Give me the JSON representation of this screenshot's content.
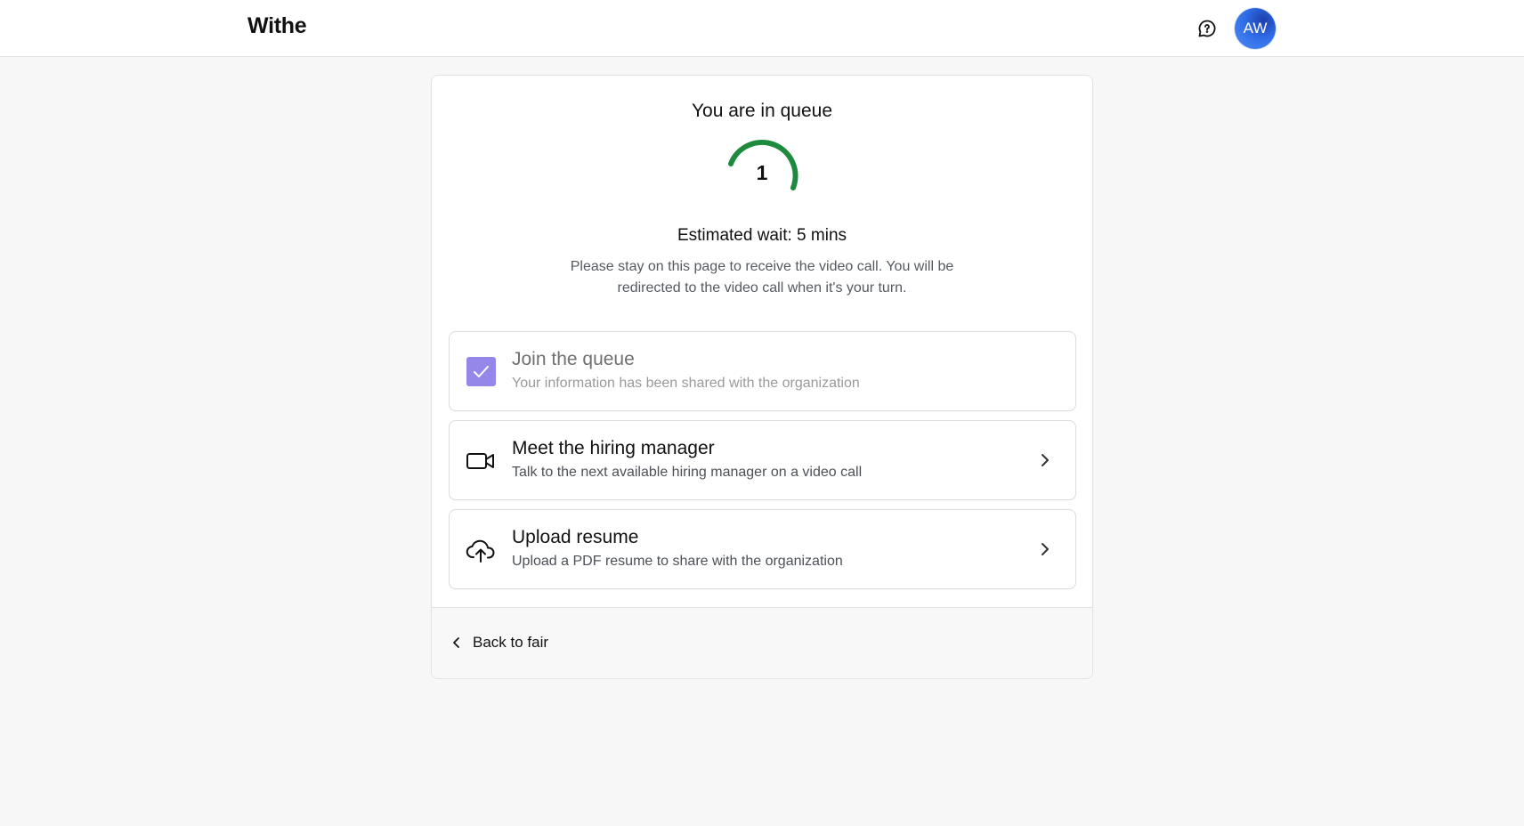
{
  "app": {
    "brand": "Withe",
    "avatar_initials": "AW",
    "icons": {
      "chat": "chat-bubble-question-icon",
      "avatar": "user-avatar"
    },
    "colors": {
      "progress": "#1d8a3e",
      "checkbox": "#9586ea",
      "avatar": "#2f6de8"
    }
  },
  "queue": {
    "title": "You are in queue",
    "position": "1",
    "estimated_wait": "Estimated wait: 5 mins",
    "info": "Please stay on this page to receive the video call. You will be redirected to the video call when it's your turn."
  },
  "steps": [
    {
      "title": "Join the queue",
      "subtitle": "Your information has been shared with the organization",
      "icon": "checkbox-checked-icon",
      "completed": true
    },
    {
      "title": "Meet the hiring manager",
      "subtitle": "Talk to the next available hiring manager on a video call",
      "icon": "video-camera-icon",
      "completed": false
    },
    {
      "title": "Upload resume",
      "subtitle": "Upload a PDF resume to share with the organization",
      "icon": "cloud-upload-icon",
      "completed": false
    }
  ],
  "footer": {
    "back_label": "Back to fair"
  }
}
